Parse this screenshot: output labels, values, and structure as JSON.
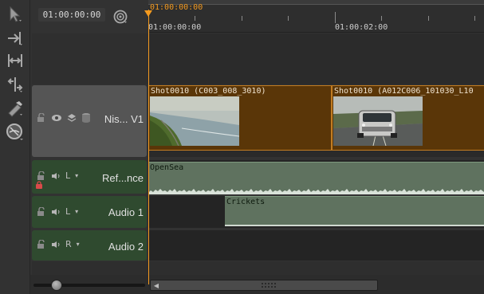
{
  "header": {
    "timecode": "01:00:00:00",
    "playhead_timecode": "01:00:00:00",
    "ruler_labels": [
      "01:00:00:00",
      "01:00:02:00"
    ]
  },
  "tools": [
    {
      "name": "select-tool",
      "icon": "arrow-cursor-icon"
    },
    {
      "name": "track-select-tool",
      "icon": "track-select-icon"
    },
    {
      "name": "slip-tool",
      "icon": "slip-icon"
    },
    {
      "name": "slide-tool",
      "icon": "slide-icon"
    },
    {
      "name": "razor-tool",
      "icon": "razor-icon"
    },
    {
      "name": "zoom-tool",
      "icon": "zoom-globe-icon"
    }
  ],
  "tracks": {
    "video1": {
      "name": "Nis... V1",
      "clips": [
        {
          "title": "Shot0010 (C003_008_3010)"
        },
        {
          "title": "Shot0010 (A012C006_101030_L10"
        }
      ]
    },
    "reference": {
      "name": "Ref...nce",
      "channel": "L",
      "clips": [
        {
          "title": "OpenSea"
        }
      ]
    },
    "audio1": {
      "name": "Audio 1",
      "channel": "L",
      "clips": [
        {
          "title": "Crickets"
        }
      ]
    },
    "audio2": {
      "name": "Audio 2",
      "channel": "R",
      "clips": []
    }
  },
  "colors": {
    "playhead": "#f49a1f",
    "video_clip_fill": "#5a3608",
    "video_clip_border": "#c27c22",
    "audio_clip_fill": "#5f725f",
    "audio_header": "#2f4a2f",
    "video_header": "#555555"
  }
}
